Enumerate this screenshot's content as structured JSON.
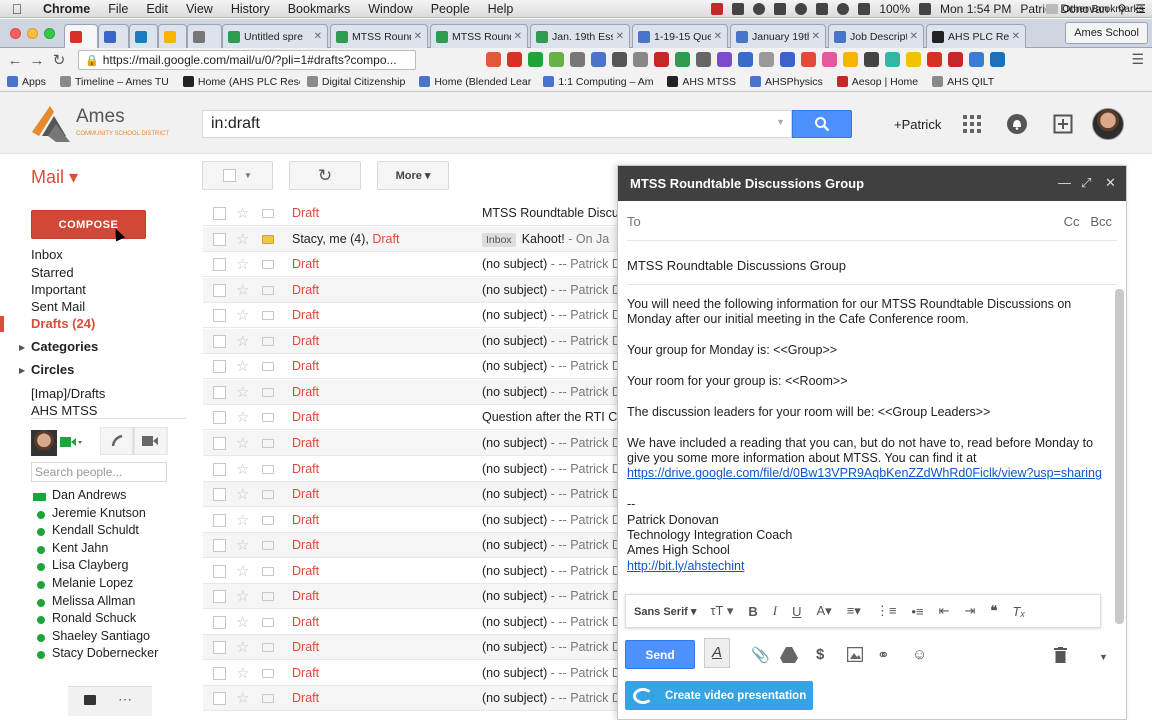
{
  "mac_menu": {
    "app": "Chrome",
    "items": [
      "File",
      "Edit",
      "View",
      "History",
      "Bookmarks",
      "Window",
      "People",
      "Help"
    ],
    "battery": "100%",
    "clock": "Mon 1:54 PM",
    "user": "Patrick Donovan"
  },
  "tabs": [
    {
      "label": "",
      "color": "#d93025",
      "active": true
    },
    {
      "label": "",
      "color": "#3b63c9"
    },
    {
      "label": "",
      "color": "#1b7ac2"
    },
    {
      "label": "",
      "color": "#f7b500"
    },
    {
      "label": "",
      "color": "#777777"
    },
    {
      "label": "Untitled spre",
      "color": "#2e9c50"
    },
    {
      "label": "MTSS Roundt",
      "color": "#2e9c50"
    },
    {
      "label": "MTSS Roundt",
      "color": "#2e9c50"
    },
    {
      "label": "Jan. 19th Esse",
      "color": "#2e9c50"
    },
    {
      "label": "1-19-15 Que",
      "color": "#4a74c9"
    },
    {
      "label": "January 19th",
      "color": "#4a74c9"
    },
    {
      "label": "Job Descriptio",
      "color": "#4a74c9"
    },
    {
      "label": "AHS PLC Reso",
      "color": "#222222"
    }
  ],
  "profile_badge": "Ames School",
  "omnibox": {
    "url": "https://mail.google.com/mail/u/0/?pli=1#drafts?compo..."
  },
  "bookmarks": [
    {
      "label": "Apps",
      "color": "#4a74c9"
    },
    {
      "label": "Timeline – Ames TU",
      "color": "#8a8a8a"
    },
    {
      "label": "Home (AHS PLC Reso",
      "color": "#222222"
    },
    {
      "label": "Digital Citizenship",
      "color": "#8a8a8a"
    },
    {
      "label": "Home (Blended Lear",
      "color": "#4a74c9"
    },
    {
      "label": "1:1 Computing – Am",
      "color": "#4a74c9"
    },
    {
      "label": "AHS MTSS",
      "color": "#222222"
    },
    {
      "label": "AHSPhysics",
      "color": "#4a74c9"
    },
    {
      "label": "Aesop | Home",
      "color": "#c62828"
    },
    {
      "label": "AHS QILT",
      "color": "#8a8a8a"
    }
  ],
  "other_bookmarks": "Other Bookmarks",
  "logo": {
    "name": "Ames",
    "sub": "COMMUNITY SCHOOL DISTRICT"
  },
  "search": {
    "query": "in:draft"
  },
  "header": {
    "plus_user": "+Patrick"
  },
  "left_nav": {
    "mail_label": "Mail ▾",
    "compose": "COMPOSE",
    "items": [
      "Inbox",
      "Starred",
      "Important",
      "Sent Mail"
    ],
    "drafts": "Drafts (24)",
    "categories": "Categories",
    "circles": "Circles",
    "extra": [
      "[Imap]/Drafts",
      "AHS MTSS"
    ]
  },
  "people": {
    "search_placeholder": "Search people...",
    "contacts": [
      "Dan Andrews",
      "Jeremie Knutson",
      "Kendall Schuldt",
      "Kent Jahn",
      "Lisa Clayberg",
      "Melanie Lopez",
      "Melissa Allman",
      "Ronald Schuck",
      "Shaeley Santiago",
      "Stacy Dobernecker"
    ]
  },
  "list_toolbar": {
    "more": "More ▾"
  },
  "messages": [
    {
      "sender": "Draft",
      "subject": "MTSS Roundtable Discu",
      "snippet": ""
    },
    {
      "sender_plain": "Stacy, me (4), ",
      "sender": "Draft",
      "label": "Inbox",
      "subject": "Kahoot!",
      "snippet": " - On Ja",
      "important": true
    },
    {
      "sender": "Draft",
      "subject": "(no subject)",
      "snippet": " - -- Patrick D"
    },
    {
      "sender": "Draft",
      "subject": "(no subject)",
      "snippet": " - -- Patrick D"
    },
    {
      "sender": "Draft",
      "subject": "(no subject)",
      "snippet": " - -- Patrick D"
    },
    {
      "sender": "Draft",
      "subject": "(no subject)",
      "snippet": " - -- Patrick D"
    },
    {
      "sender": "Draft",
      "subject": "(no subject)",
      "snippet": " - -- Patrick D"
    },
    {
      "sender": "Draft",
      "subject": "(no subject)",
      "snippet": " - -- Patrick D"
    },
    {
      "sender": "Draft",
      "subject": "Question after the RTI C",
      "snippet": ""
    },
    {
      "sender": "Draft",
      "subject": "(no subject)",
      "snippet": " - -- Patrick D"
    },
    {
      "sender": "Draft",
      "subject": "(no subject)",
      "snippet": " - -- Patrick D"
    },
    {
      "sender": "Draft",
      "subject": "(no subject)",
      "snippet": " - -- Patrick D"
    },
    {
      "sender": "Draft",
      "subject": "(no subject)",
      "snippet": " - -- Patrick D"
    },
    {
      "sender": "Draft",
      "subject": "(no subject)",
      "snippet": " - -- Patrick D"
    },
    {
      "sender": "Draft",
      "subject": "(no subject)",
      "snippet": " - -- Patrick D"
    },
    {
      "sender": "Draft",
      "subject": "(no subject)",
      "snippet": " - -- Patrick D"
    },
    {
      "sender": "Draft",
      "subject": "(no subject)",
      "snippet": " - -- Patrick D"
    },
    {
      "sender": "Draft",
      "subject": "(no subject)",
      "snippet": " - -- Patrick D"
    },
    {
      "sender": "Draft",
      "subject": "(no subject)",
      "snippet": " - -- Patrick D"
    },
    {
      "sender": "Draft",
      "subject": "(no subject)",
      "snippet": " - -- Patrick D"
    }
  ],
  "compose_window": {
    "title": "MTSS Roundtable Discussions Group",
    "to_label": "To",
    "cc": "Cc",
    "bcc": "Bcc",
    "subject": "MTSS Roundtable Discussions Group",
    "body": {
      "p1": "You will need the following information for our MTSS Roundtable Discussions on Monday after our initial meeting in the Cafe Conference room.",
      "p2": "Your group for Monday is: <<Group>>",
      "p3": "Your room for your group is: <<Room>>",
      "p4": "The discussion leaders for your room will be: <<Group Leaders>>",
      "p5": "We have included a reading that you can, but do not have to, read before Monday to give you some more information about MTSS.  You can find it at ",
      "p5_link": "https://drive.google.com/file/d/0Bw13VPR9AqbKenZZdWhRd0Ficlk/view?usp=sharing",
      "sig_dash": "--",
      "sig_name": "Patrick Donovan",
      "sig_title": "Technology Integration Coach",
      "sig_school": "Ames High School",
      "sig_link": "http://bit.ly/ahstechint"
    },
    "font": "Sans Serif",
    "send": "Send",
    "video_btn": "Create video presentation"
  }
}
